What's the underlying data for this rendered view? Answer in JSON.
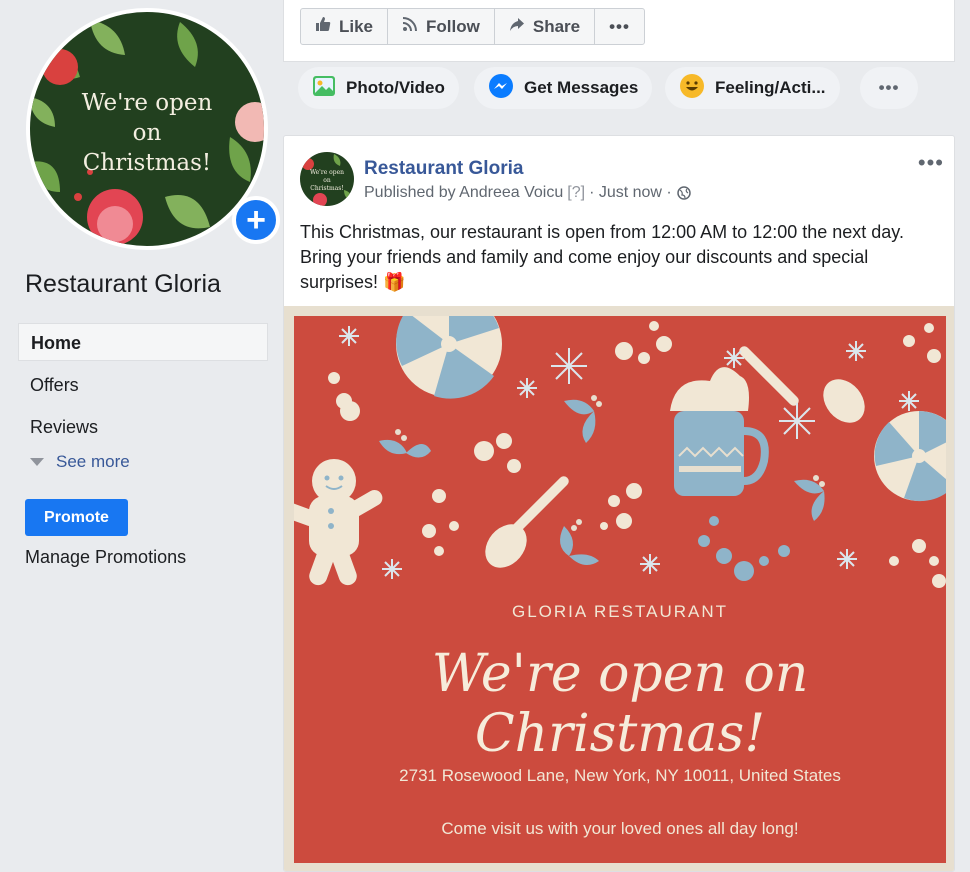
{
  "page": {
    "name": "Restaurant Gloria",
    "profile_image_text": [
      "We're open",
      "on",
      "Christmas!"
    ]
  },
  "nav": {
    "items": [
      {
        "label": "Home",
        "active": true
      },
      {
        "label": "Offers"
      },
      {
        "label": "Reviews"
      }
    ],
    "see_more": "See more",
    "promote": "Promote",
    "manage_promotions": "Manage Promotions"
  },
  "actions": [
    {
      "label": "Like",
      "icon": "thumbs-up-icon"
    },
    {
      "label": "Follow",
      "icon": "rss-icon"
    },
    {
      "label": "Share",
      "icon": "share-icon"
    },
    {
      "label": "",
      "icon": "more-icon"
    }
  ],
  "composer": {
    "photo_video": "Photo/Video",
    "get_messages": "Get Messages",
    "feeling": "Feeling/Acti..."
  },
  "post": {
    "author": "Restaurant Gloria",
    "published_by": "Published by Andreea Voicu",
    "help_marker": "[?]",
    "time": "· Just now ·",
    "text": "This Christmas, our restaurant is open from 12:00 AM to 12:00 the next day. Bring your friends and family and come enjoy our discounts and special surprises! 🎁",
    "flyer": {
      "brand": "GLORIA RESTAURANT",
      "headline": "We're open on Christmas!",
      "address": "2731  Rosewood Lane, New York, NY 10011, United States",
      "invite": "Come visit us with your loved ones all day long!"
    }
  },
  "colors": {
    "brand_blue": "#1877f2",
    "link_blue": "#385898",
    "flyer_red": "#cc4b3e",
    "holly_green": "#22401f"
  }
}
